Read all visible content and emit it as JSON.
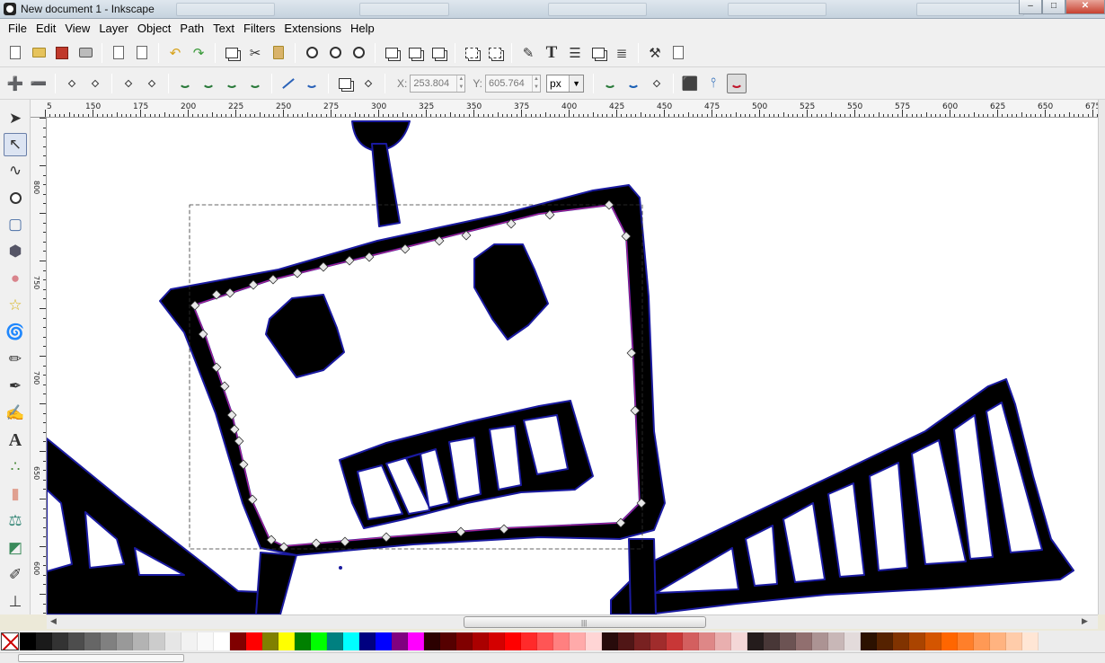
{
  "window": {
    "title": "New document 1 - Inkscape",
    "minimize": "–",
    "maximize": "□",
    "close": "✕"
  },
  "menubar": [
    "File",
    "Edit",
    "View",
    "Layer",
    "Object",
    "Path",
    "Text",
    "Filters",
    "Extensions",
    "Help"
  ],
  "controls": {
    "x_label": "X:",
    "x_value": "253.804",
    "y_label": "Y:",
    "y_value": "605.764",
    "unit": "px"
  },
  "ruler": {
    "h_labels": [
      "5",
      "150",
      "175",
      "200",
      "225",
      "250",
      "275",
      "300",
      "325",
      "350",
      "375",
      "400",
      "425",
      "450",
      "475",
      "500",
      "525",
      "550",
      "575",
      "600",
      "625",
      "650",
      "675"
    ],
    "v_labels": [
      "800",
      "750",
      "700",
      "650",
      "600"
    ]
  },
  "tools": [
    "selector-tool",
    "node-tool",
    "tweak-tool",
    "zoom-tool",
    "rectangle-tool",
    "3dbox-tool",
    "ellipse-tool",
    "star-tool",
    "spiral-tool",
    "pencil-tool",
    "pen-tool",
    "calligraphy-tool",
    "text-tool",
    "spray-tool",
    "eraser-tool",
    "paint-bucket-tool",
    "gradient-tool",
    "dropper-tool",
    "connector-tool"
  ],
  "palette": [
    "#000000",
    "#1a1a1a",
    "#333333",
    "#4d4d4d",
    "#666666",
    "#808080",
    "#999999",
    "#b3b3b3",
    "#cccccc",
    "#e6e6e6",
    "#f2f2f2",
    "#f9f9f9",
    "#ffffff",
    "#800000",
    "#ff0000",
    "#808000",
    "#ffff00",
    "#008000",
    "#00ff00",
    "#008080",
    "#00ffff",
    "#000080",
    "#0000ff",
    "#800080",
    "#ff00ff",
    "#2b0000",
    "#550000",
    "#800000",
    "#aa0000",
    "#d40000",
    "#ff0000",
    "#ff2a2a",
    "#ff5555",
    "#ff8080",
    "#ffaaaa",
    "#ffd5d5",
    "#280b0b",
    "#501616",
    "#782121",
    "#a02c2c",
    "#c83737",
    "#d35f5f",
    "#de8787",
    "#e9afaf",
    "#f4d7d7",
    "#241c1c",
    "#483737",
    "#6c5353",
    "#916f6f",
    "#ac9393",
    "#c8b7b7",
    "#e3dbdb",
    "#2b1100",
    "#552200",
    "#803300",
    "#aa4400",
    "#d45500",
    "#ff6600",
    "#ff7f2a",
    "#ff9955",
    "#ffb380",
    "#ffccaa",
    "#ffe6d5"
  ]
}
